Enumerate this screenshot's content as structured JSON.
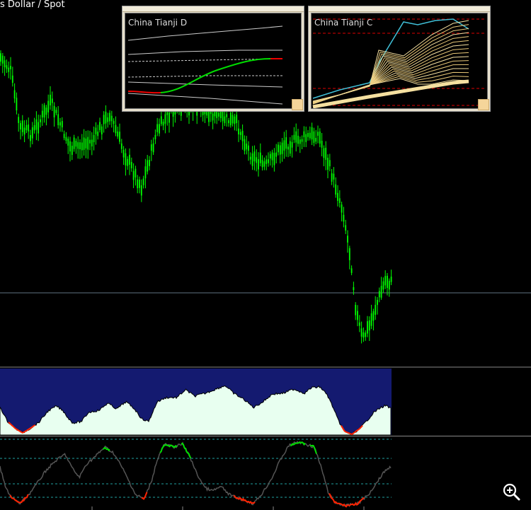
{
  "header": {
    "title": "s Dollar / Spot"
  },
  "panels": [
    {
      "title": "China Tianji D"
    },
    {
      "title": "China Tianji C"
    }
  ],
  "colors": {
    "background": "#000000",
    "candle": "#00ff00",
    "bottom_curve_red": "#ff2200",
    "fill_dark": "#141a70",
    "fill_light": "#e8fff0",
    "osc_line": "#555555",
    "osc_band": "#20c0c0"
  },
  "icons": {
    "zoom": "zoom-in-icon"
  }
}
